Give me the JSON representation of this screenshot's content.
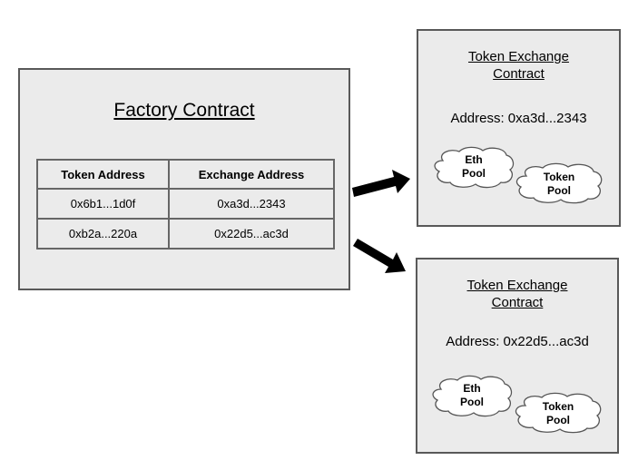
{
  "factory": {
    "title": "Factory Contract",
    "table": {
      "headers": [
        "Token Address",
        "Exchange Address"
      ],
      "rows": [
        [
          "0x6b1...1d0f",
          "0xa3d...2343"
        ],
        [
          "0xb2a...220a",
          "0x22d5...ac3d"
        ]
      ]
    }
  },
  "exchanges": [
    {
      "title_line1": "Token Exchange",
      "title_line2": "Contract",
      "address": "Address: 0xa3d...2343",
      "pools": [
        {
          "line1": "Eth",
          "line2": "Pool"
        },
        {
          "line1": "Token",
          "line2": "Pool"
        }
      ]
    },
    {
      "title_line1": "Token Exchange",
      "title_line2": "Contract",
      "address": "Address: 0x22d5...ac3d",
      "pools": [
        {
          "line1": "Eth",
          "line2": "Pool"
        },
        {
          "line1": "Token",
          "line2": "Pool"
        }
      ]
    }
  ],
  "colors": {
    "box_fill": "#ebebeb",
    "box_border": "#595959",
    "arrow": "#000000",
    "cloud_fill": "#ffffff",
    "cloud_stroke": "#555555"
  }
}
